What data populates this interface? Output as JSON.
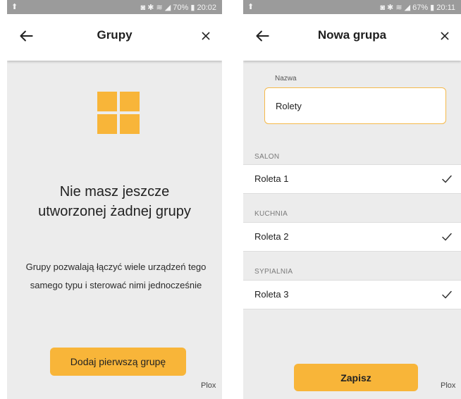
{
  "left_screen": {
    "status": {
      "left": "⬆",
      "right": "◙ ✱ ≋ ◢ 70% ▮ 20:02"
    },
    "title": "Grupy",
    "empty_title": "Nie masz jeszcze utworzonej żadnej grupy",
    "description": "Grupy pozwalają łączyć wiele urządzeń tego samego typu i sterować nimi jednocześnie",
    "add_button": "Dodaj pierwszą grupę",
    "brand": "Plox"
  },
  "right_screen": {
    "status": {
      "left": "⬆",
      "right": "◙ ✱ ≋ ◢ 67% ▮ 20:11"
    },
    "title": "Nowa grupa",
    "name_label": "Nazwa",
    "name_value": "Rolety",
    "sections": [
      {
        "label": "SALON",
        "device": "Roleta 1"
      },
      {
        "label": "KUCHNIA",
        "device": "Roleta 2"
      },
      {
        "label": "SYPIALNIA",
        "device": "Roleta 3"
      }
    ],
    "save_button": "Zapisz",
    "brand": "Plox"
  },
  "colors": {
    "accent": "#f8b539",
    "background": "#ececec",
    "statusbar": "#9b9b9b"
  },
  "icons": [
    "back-arrow-icon",
    "close-icon",
    "grid-icon",
    "check-icon"
  ]
}
